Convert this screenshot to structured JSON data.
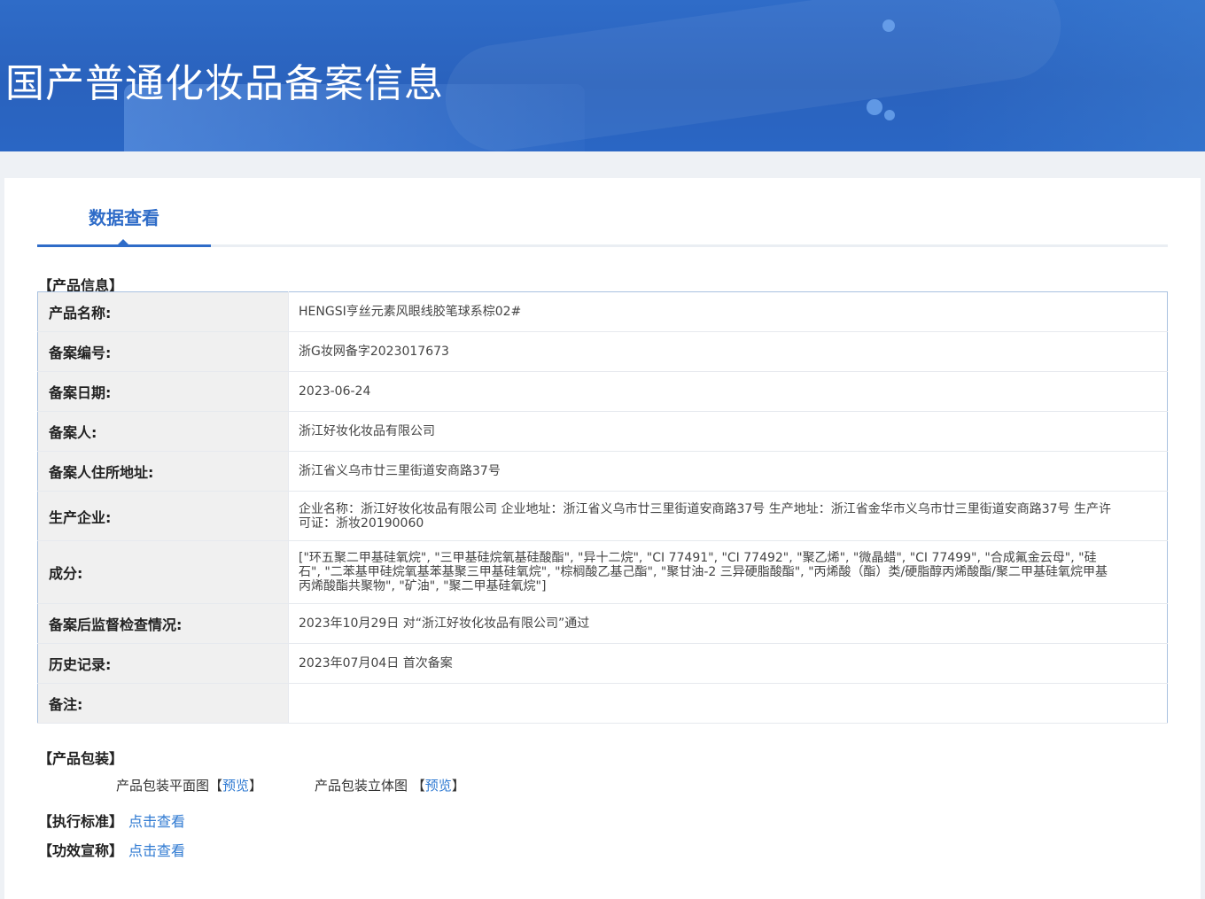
{
  "header": {
    "title": "国产普通化妆品备案信息"
  },
  "tab": {
    "label": "数据查看"
  },
  "product_info": {
    "section_title": "【产品信息】",
    "rows": [
      {
        "label": "产品名称:",
        "value": "HENGSI亨丝元素风眼线胶笔球系棕02#"
      },
      {
        "label": "备案编号:",
        "value": "浙G妆网备字2023017673"
      },
      {
        "label": "备案日期:",
        "value": "2023-06-24"
      },
      {
        "label": "备案人:",
        "value": "浙江好妆化妆品有限公司"
      },
      {
        "label": "备案人住所地址:",
        "value": "浙江省义乌市廿三里街道安商路37号"
      },
      {
        "label": "生产企业:",
        "value": "企业名称：浙江好妆化妆品有限公司 企业地址：浙江省义乌市廿三里街道安商路37号 生产地址：浙江省金华市义乌市廿三里街道安商路37号 生产许可证：浙妆20190060"
      },
      {
        "label": "成分:",
        "value": "[\"环五聚二甲基硅氧烷\", \"三甲基硅烷氧基硅酸酯\", \"异十二烷\", \"CI 77491\", \"CI 77492\", \"聚乙烯\", \"微晶蜡\", \"CI 77499\", \"合成氟金云母\", \"硅石\", \"二苯基甲硅烷氧基苯基聚三甲基硅氧烷\", \"棕榈酸乙基己酯\", \"聚甘油-2 三异硬脂酸酯\", \"丙烯酸（酯）类/硬脂醇丙烯酸酯/聚二甲基硅氧烷甲基丙烯酸酯共聚物\", \"矿油\", \"聚二甲基硅氧烷\"]"
      },
      {
        "label": "备案后监督检查情况:",
        "value": "2023年10月29日 对“浙江好妆化妆品有限公司”通过"
      },
      {
        "label": "历史记录:",
        "value": "2023年07月04日 首次备案"
      },
      {
        "label": "备注:",
        "value": ""
      }
    ]
  },
  "packaging": {
    "section_title": "【产品包装】",
    "flat_label": "产品包装平面图",
    "flat_link": "预览",
    "solid_label": "产品包装立体图",
    "solid_link": "预览"
  },
  "standard": {
    "label": "【执行标准】",
    "link": "点击查看"
  },
  "efficacy": {
    "label": "【功效宣称】",
    "link": "点击查看"
  }
}
